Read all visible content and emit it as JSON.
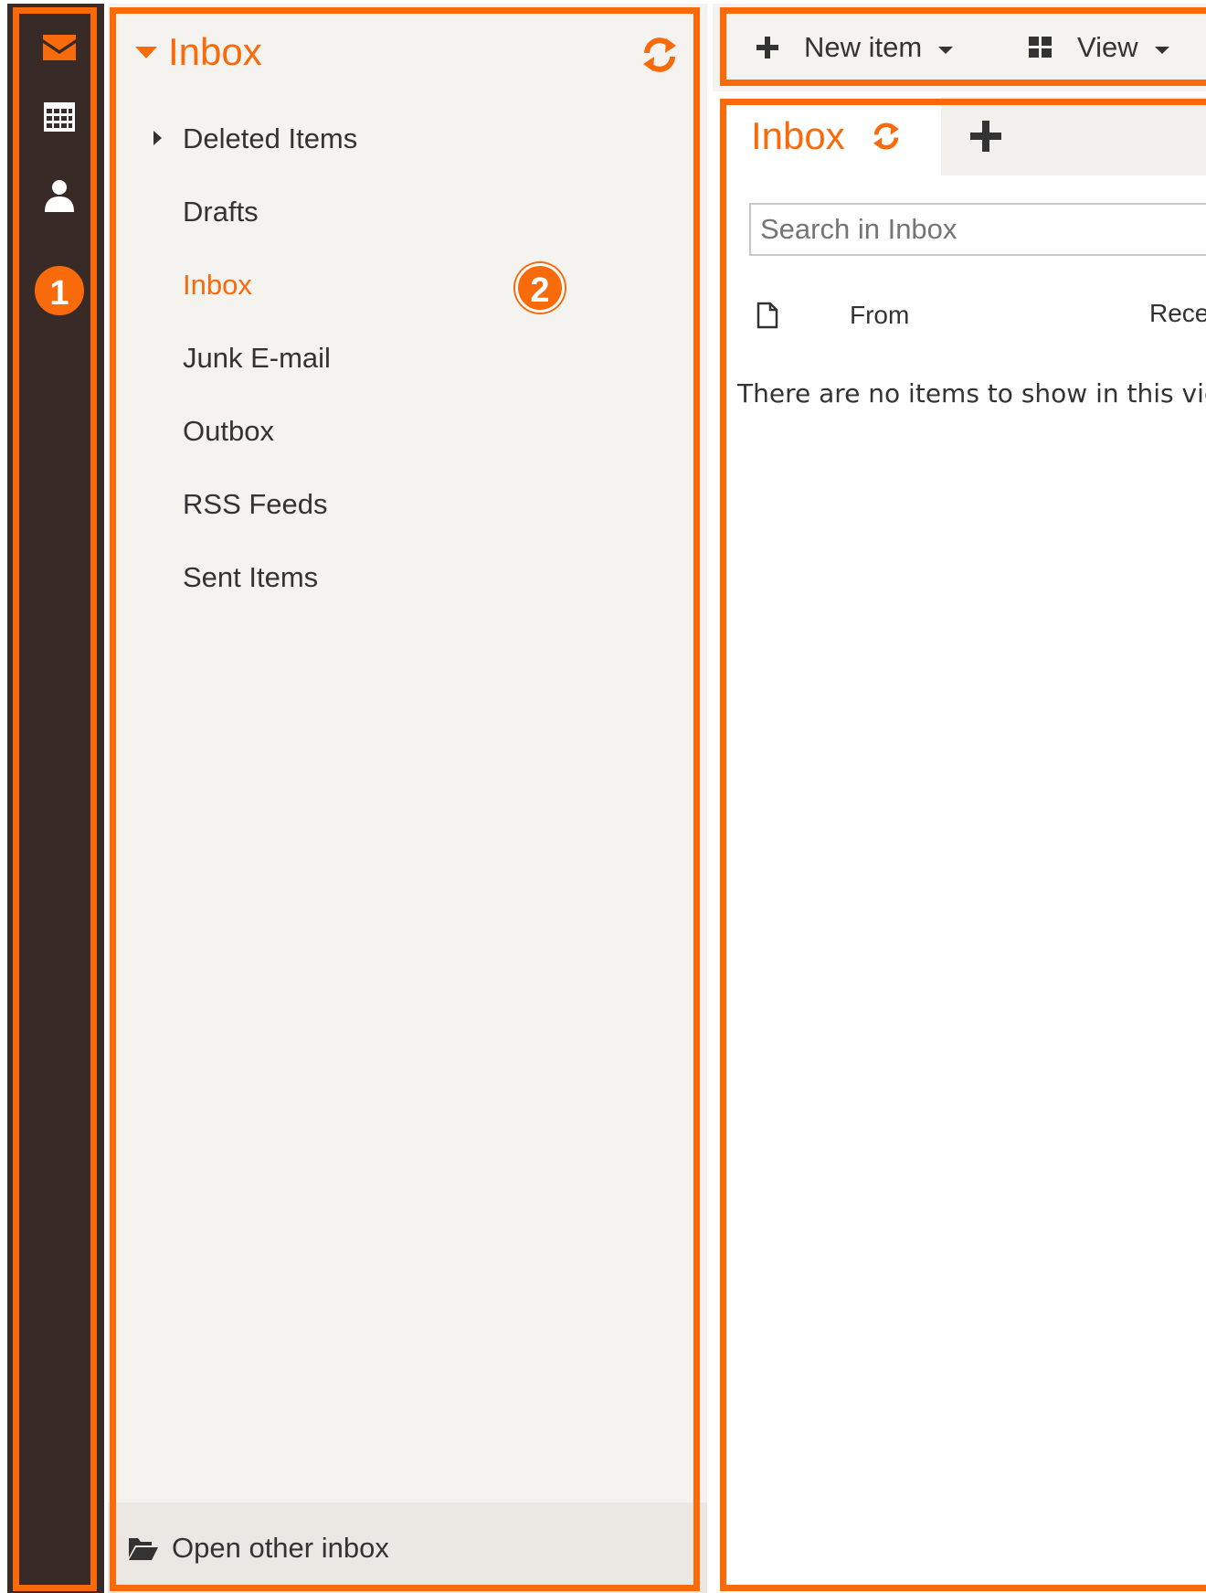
{
  "colors": {
    "accent": "#f96a0b",
    "rail_background": "#382b27",
    "pane_background": "#f5f3ef",
    "text": "#333333"
  },
  "rail": {
    "icons": [
      "mail-icon",
      "calendar-icon",
      "contacts-icon"
    ],
    "badge": "1"
  },
  "folders": {
    "title": "Inbox",
    "badge": "2",
    "items": [
      {
        "label": "Deleted Items",
        "expandable": true
      },
      {
        "label": "Drafts"
      },
      {
        "label": "Inbox",
        "active": true
      },
      {
        "label": "Junk E-mail"
      },
      {
        "label": "Outbox"
      },
      {
        "label": "RSS Feeds"
      },
      {
        "label": "Sent Items"
      }
    ],
    "footer_label": "Open other inbox"
  },
  "toolbar": {
    "new_item_label": "New item",
    "view_label": "View"
  },
  "main": {
    "tab_title": "Inbox",
    "search_placeholder": "Search in Inbox",
    "columns": {
      "from": "From",
      "received": "Rece"
    },
    "empty_message": "There are no items to show in this view"
  }
}
